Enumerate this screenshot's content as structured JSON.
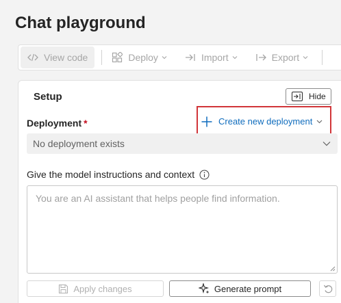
{
  "page": {
    "title": "Chat playground"
  },
  "toolbar": {
    "view_code": "View code",
    "deploy": "Deploy",
    "import": "Import",
    "export": "Export"
  },
  "setup": {
    "title": "Setup",
    "hide_label": "Hide",
    "deployment": {
      "label": "Deployment",
      "required_mark": "*",
      "create_link": "Create new deployment",
      "select_value": "No deployment exists"
    },
    "instructions": {
      "label": "Give the model instructions and context",
      "placeholder": "You are an AI assistant that helps people find information."
    },
    "buttons": {
      "apply": "Apply changes",
      "generate": "Generate prompt"
    }
  },
  "colors": {
    "accent": "#0f6cbd",
    "highlight_border": "#d13438",
    "required": "#c50f1f"
  },
  "icons": [
    "code-icon",
    "deploy-icon",
    "import-icon",
    "export-icon",
    "hide-panel-icon",
    "plus-icon",
    "chevron-down-icon",
    "info-icon",
    "save-icon",
    "sparkle-icon",
    "undo-icon"
  ]
}
